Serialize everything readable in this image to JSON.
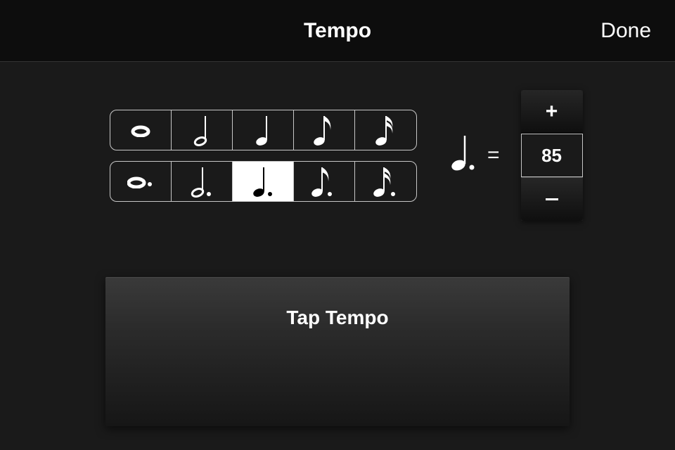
{
  "header": {
    "title": "Tempo",
    "done_label": "Done"
  },
  "notes": {
    "row1": [
      {
        "name": "whole",
        "selected": false
      },
      {
        "name": "half",
        "selected": false
      },
      {
        "name": "quarter",
        "selected": false
      },
      {
        "name": "eighth",
        "selected": false
      },
      {
        "name": "sixteenth",
        "selected": false
      }
    ],
    "row2": [
      {
        "name": "dotted-whole",
        "selected": false
      },
      {
        "name": "dotted-half",
        "selected": false
      },
      {
        "name": "dotted-quarter",
        "selected": true
      },
      {
        "name": "dotted-eighth",
        "selected": false
      },
      {
        "name": "dotted-sixteenth",
        "selected": false
      }
    ]
  },
  "equation": {
    "selected_note": "dotted-quarter",
    "equals_label": "="
  },
  "stepper": {
    "plus_label": "+",
    "minus_label": "−",
    "value": "85"
  },
  "tap_tempo": {
    "label": "Tap Tempo"
  }
}
